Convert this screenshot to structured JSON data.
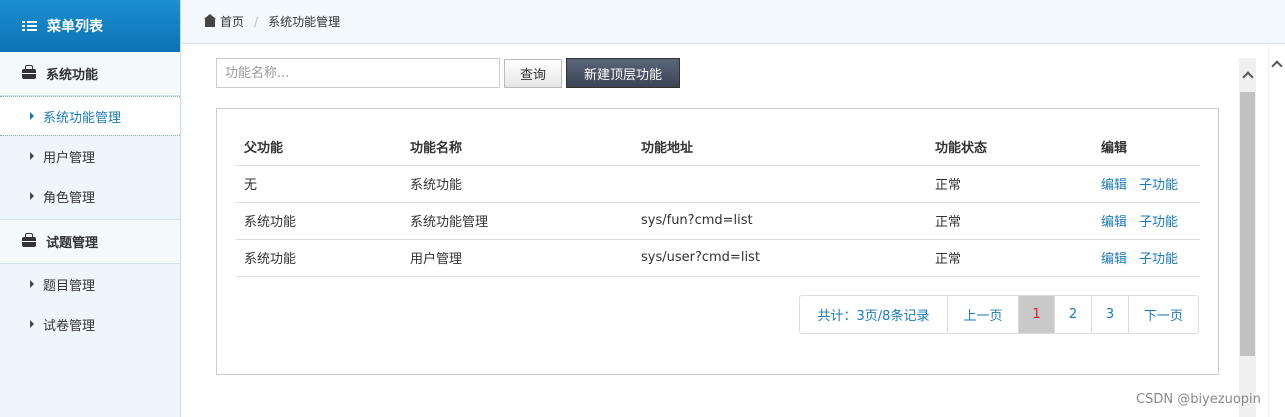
{
  "sidebar": {
    "title": "菜单列表",
    "groups": [
      {
        "label": "系统功能",
        "items": [
          {
            "label": "系统功能管理",
            "active": true
          },
          {
            "label": "用户管理"
          },
          {
            "label": "角色管理"
          }
        ]
      },
      {
        "label": "试题管理",
        "items": [
          {
            "label": "题目管理"
          },
          {
            "label": "试卷管理"
          }
        ]
      }
    ]
  },
  "breadcrumb": {
    "home": "首页",
    "current": "系统功能管理"
  },
  "search": {
    "placeholder": "功能名称...",
    "query_label": "查询",
    "new_label": "新建顶层功能"
  },
  "table": {
    "headers": [
      "父功能",
      "功能名称",
      "功能地址",
      "功能状态",
      "编辑"
    ],
    "rows": [
      {
        "parent": "无",
        "name": "系统功能",
        "url": "",
        "status": "正常"
      },
      {
        "parent": "系统功能",
        "name": "系统功能管理",
        "url": "sys/fun?cmd=list",
        "status": "正常"
      },
      {
        "parent": "系统功能",
        "name": "用户管理",
        "url": "sys/user?cmd=list",
        "status": "正常"
      }
    ],
    "edit_label": "编辑",
    "child_label": "子功能"
  },
  "pager": {
    "summary": "共计：3页/8条记录",
    "prev": "上一页",
    "pages": [
      "1",
      "2",
      "3"
    ],
    "current": "1",
    "next": "下一页"
  },
  "watermark": "CSDN @biyezuopin",
  "colors": {
    "accent": "#1a7bb9",
    "header_blue": "#1b8fd1",
    "current_page": "#e02020"
  }
}
